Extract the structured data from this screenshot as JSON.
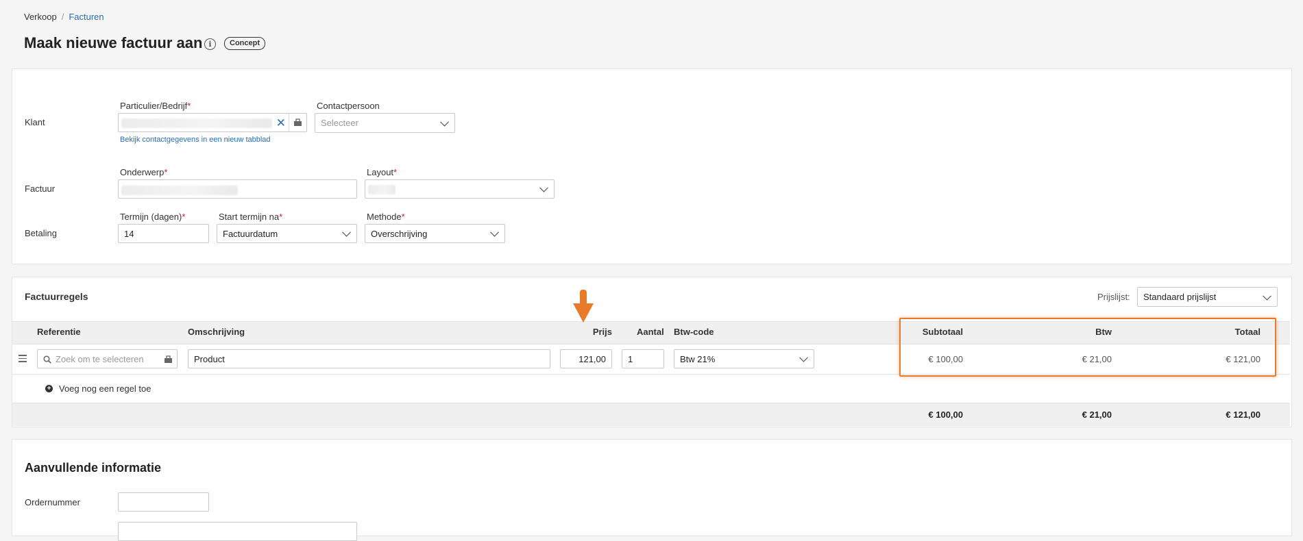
{
  "breadcrumb": {
    "parent": "Verkoop",
    "separator": "/",
    "current": "Facturen"
  },
  "page": {
    "title": "Maak nieuwe factuur aan",
    "status": "Concept"
  },
  "klant": {
    "row_label": "Klant",
    "customer_label": "Particulier/Bedrijf",
    "contact_label": "Contactpersoon",
    "contact_placeholder": "Selecteer",
    "contact_link": "Bekijk contactgegevens in een nieuw tabblad"
  },
  "factuur": {
    "row_label": "Factuur",
    "subject_label": "Onderwerp",
    "layout_label": "Layout"
  },
  "betaling": {
    "row_label": "Betaling",
    "term_label": "Termijn (dagen)",
    "term_value": "14",
    "start_label": "Start termijn na",
    "start_value": "Factuurdatum",
    "method_label": "Methode",
    "method_value": "Overschrijving"
  },
  "lines": {
    "title": "Factuurregels",
    "pricelist_label": "Prijslijst:",
    "pricelist_value": "Standaard prijslijst",
    "headers": {
      "referentie": "Referentie",
      "omschrijving": "Omschrijving",
      "prijs": "Prijs",
      "aantal": "Aantal",
      "btw_code": "Btw-code",
      "subtotaal": "Subtotaal",
      "btw": "Btw",
      "totaal": "Totaal"
    },
    "rows": [
      {
        "reference_placeholder": "Zoek om te selecteren",
        "description": "Product",
        "price": "121,00",
        "quantity": "1",
        "vat_code": "Btw 21%",
        "subtotal": "€ 100,00",
        "vat": "€ 21,00",
        "total": "€ 121,00"
      }
    ],
    "add_line": "Voeg nog een regel toe",
    "totals": {
      "subtotal": "€ 100,00",
      "vat": "€ 21,00",
      "total": "€ 121,00"
    }
  },
  "extra": {
    "title": "Aanvullende informatie",
    "order_label": "Ordernummer"
  },
  "colors": {
    "accent": "#e87a2a",
    "link": "#2a6cb0",
    "required": "#c81e1e"
  }
}
